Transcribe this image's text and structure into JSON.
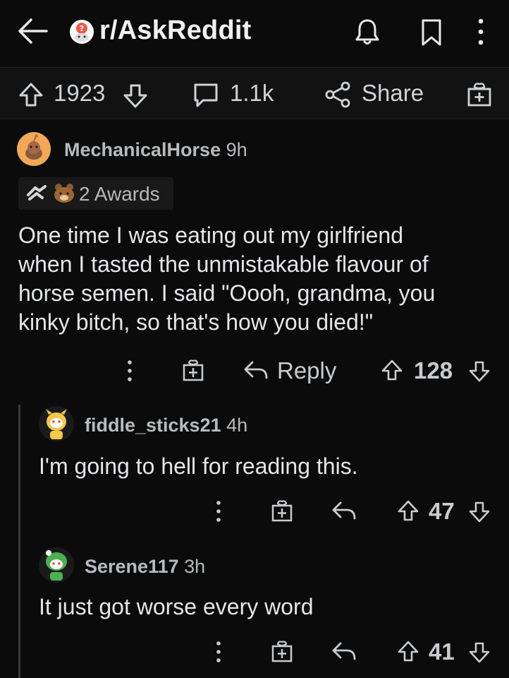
{
  "header": {
    "subreddit": "r/AskReddit"
  },
  "post_actions": {
    "upvotes": "1923",
    "comments": "1.1k",
    "share_label": "Share"
  },
  "comments": [
    {
      "author": "MechanicalHorse",
      "time": "9h",
      "awards_label": "2 Awards",
      "body_lines": [
        "One time I was eating out my girlfriend",
        "when I tasted the unmistakable flavour of",
        "horse semen. I said \"Oooh, grandma, you",
        "kinky bitch, so that's how you died!\""
      ],
      "reply_label": "Reply",
      "score": "128"
    },
    {
      "author": "fiddle_sticks21",
      "time": "4h",
      "body": "I'm going to hell for reading this.",
      "score": "47"
    },
    {
      "author": "Serene117",
      "time": "3h",
      "body": "It just got worse every word",
      "score": "41"
    }
  ],
  "colors": {
    "background": "#0b0b0b",
    "text": "#d7dadc",
    "avatar_orange": "#f0a84a",
    "avatar_green": "#4caf50",
    "avatar_yellow": "#f2c94c"
  }
}
